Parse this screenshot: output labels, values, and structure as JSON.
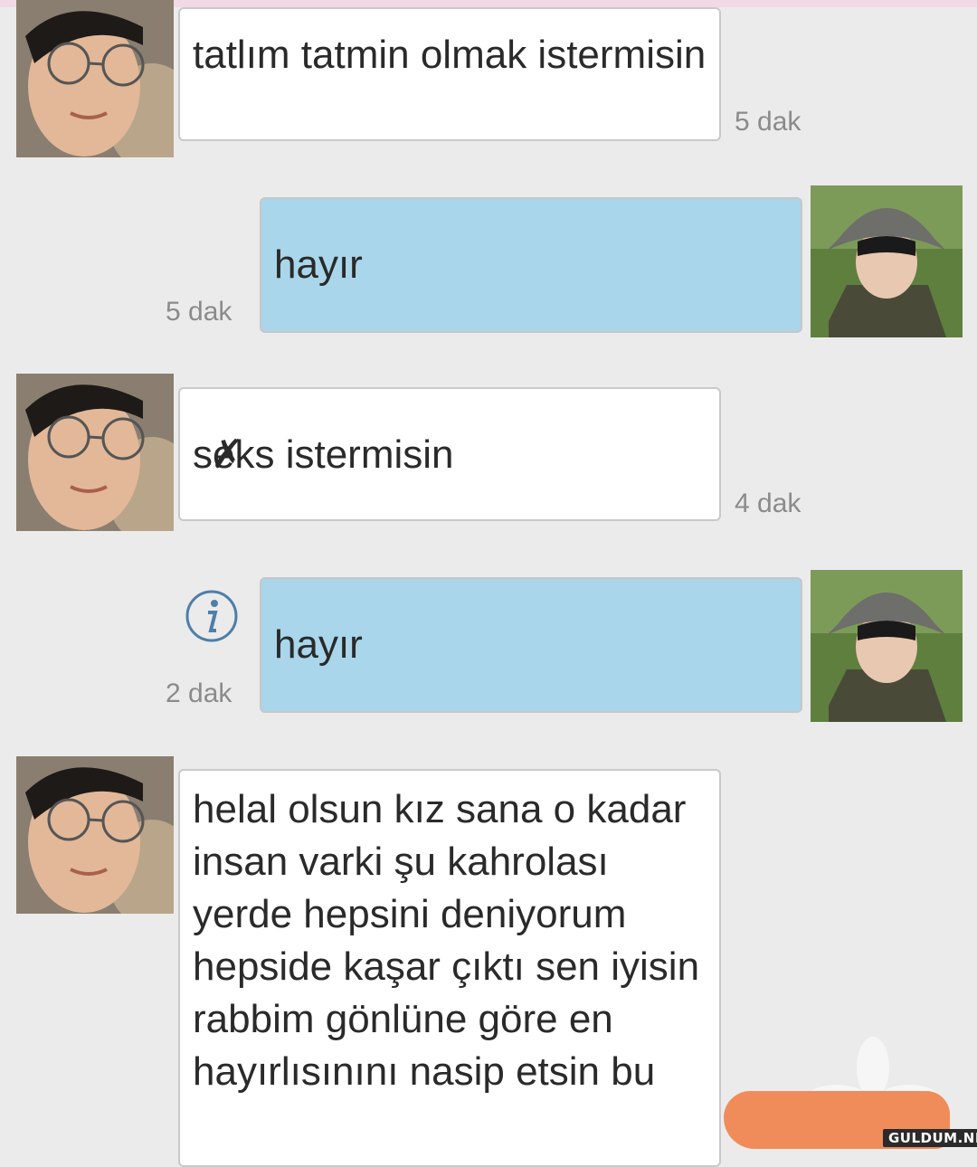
{
  "colors": {
    "background": "#ebebeb",
    "incoming_bubble": "#ffffff",
    "outgoing_bubble": "#a9d6ea",
    "timestamp": "#8b8b8b",
    "info_icon": "#4d7fa8",
    "redaction": "#f08c5a"
  },
  "messages": [
    {
      "sender": "other",
      "text": "tatlım tatmin olmak istermisin",
      "time": "5 dak"
    },
    {
      "sender": "me",
      "text": "hayır",
      "time": "5 dak"
    },
    {
      "sender": "other",
      "text_pre": "s",
      "text_struck": "e",
      "text_post": "ks istermisin",
      "time": "4 dak"
    },
    {
      "sender": "me",
      "text": "hayır",
      "time": "2 dak",
      "icon": "info-icon"
    },
    {
      "sender": "other",
      "text": "helal olsun kız sana o kadar insan varki şu kahrolası yerde hepsini deniyorum hepside kaşar çıktı sen iyisin rabbim gönlüne göre en hayırlısınını nasip etsin bu"
    }
  ],
  "watermark": "GULDUM.NET"
}
